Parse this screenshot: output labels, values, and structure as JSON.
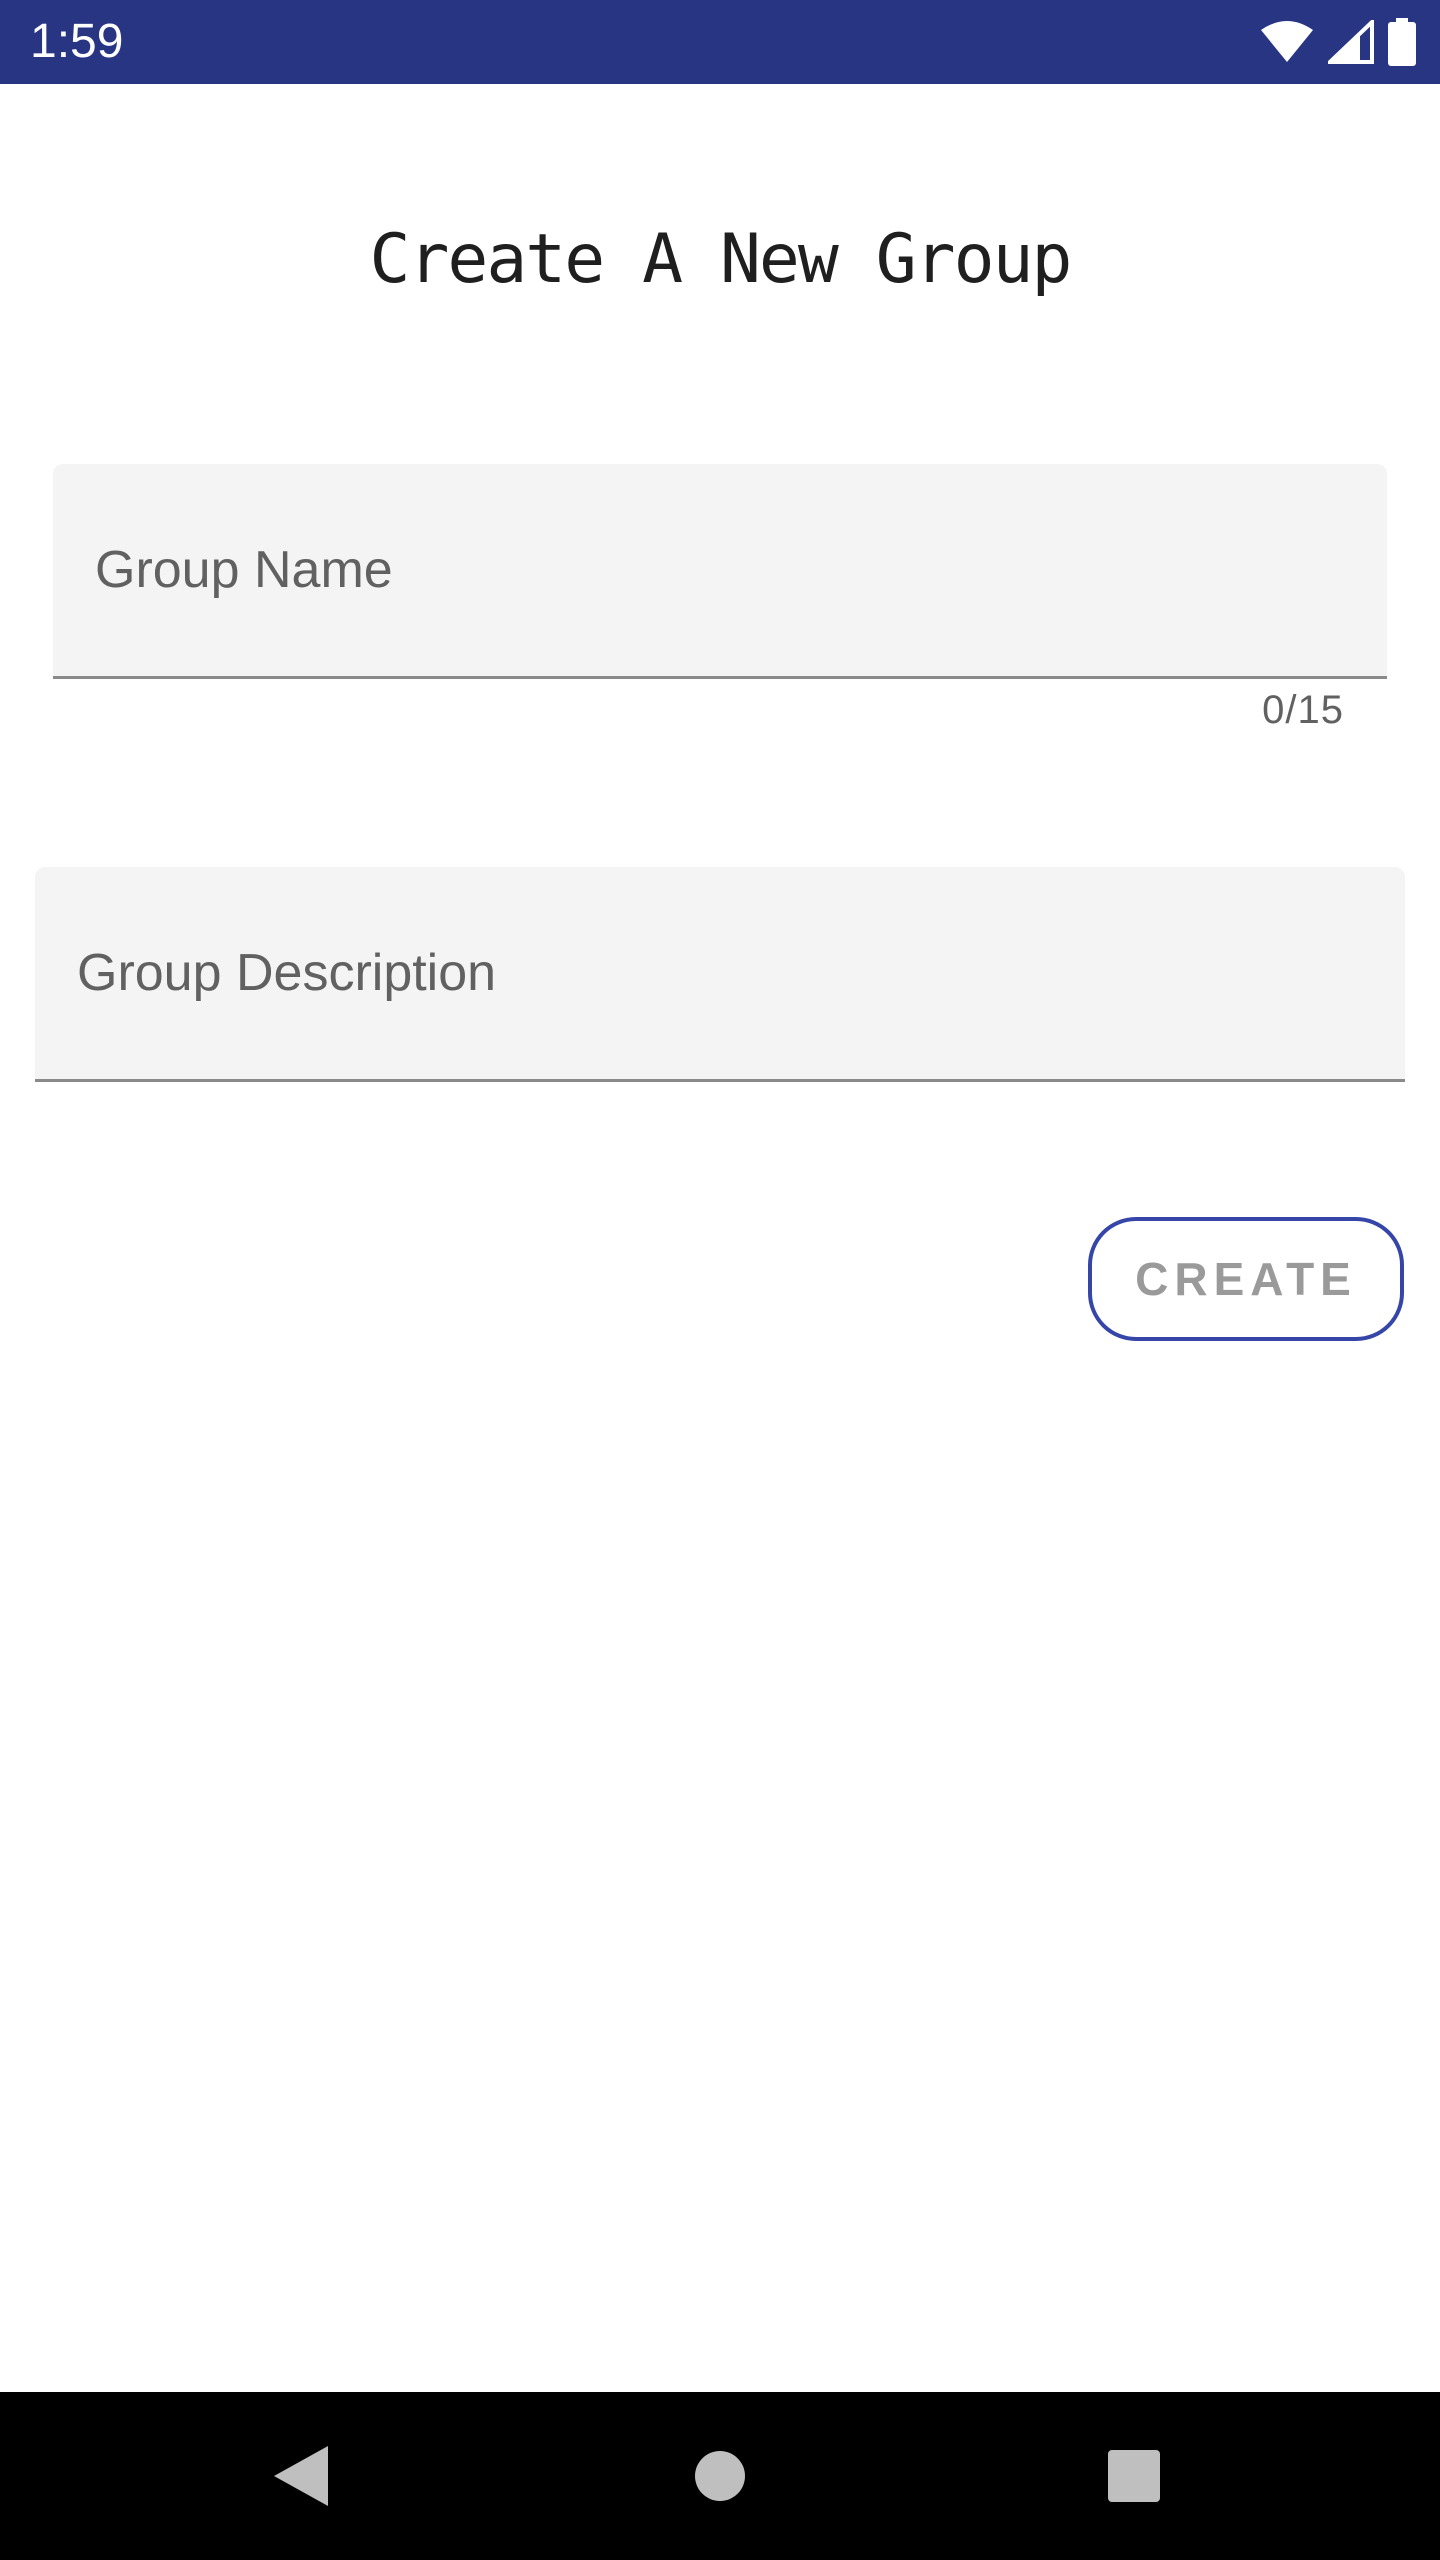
{
  "status_bar": {
    "time": "1:59",
    "background_color": "#283583",
    "icons": [
      "wifi-icon",
      "cell-signal-icon",
      "battery-icon"
    ]
  },
  "page": {
    "title": "Create A New Group"
  },
  "form": {
    "group_name": {
      "label": "Group Name",
      "value": "",
      "counter": "0/15"
    },
    "group_description": {
      "label": "Group Description",
      "value": ""
    },
    "create_label": "CREATE",
    "accent_color": "#3646a8"
  },
  "nav_bar": {
    "icons": [
      "back-icon",
      "home-icon",
      "recents-icon"
    ]
  }
}
